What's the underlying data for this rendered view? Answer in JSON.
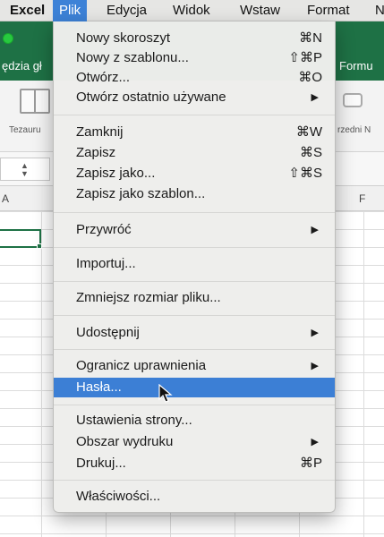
{
  "menubar": {
    "items": [
      "Excel",
      "Plik",
      "Edycja",
      "Widok",
      "Wstaw",
      "Format",
      "N"
    ]
  },
  "ribbon": {
    "tab_left": "ędzia gł",
    "tab_right": "Formu",
    "left_label": "Tezauru",
    "right_label": "rzedni N"
  },
  "sheet": {
    "columns": [
      "A",
      "F"
    ]
  },
  "file_menu": {
    "items": [
      {
        "label": "Nowy skoroszyt",
        "shortcut": "⌘N"
      },
      {
        "label": "Nowy z szablonu...",
        "shortcut": "⇧⌘P"
      },
      {
        "label": "Otwórz...",
        "shortcut": "⌘O"
      },
      {
        "label": "Otwórz ostatnio używane",
        "shortcut": "▶"
      },
      {
        "label": "Zamknij",
        "shortcut": "⌘W"
      },
      {
        "label": "Zapisz",
        "shortcut": "⌘S"
      },
      {
        "label": "Zapisz jako...",
        "shortcut": "⇧⌘S"
      },
      {
        "label": "Zapisz jako szablon...",
        "shortcut": ""
      },
      {
        "label": "Przywróć",
        "shortcut": "▶"
      },
      {
        "label": "Importuj...",
        "shortcut": ""
      },
      {
        "label": "Zmniejsz rozmiar pliku...",
        "shortcut": ""
      },
      {
        "label": "Udostępnij",
        "shortcut": "▶"
      },
      {
        "label": "Ogranicz uprawnienia",
        "shortcut": "▶"
      },
      {
        "label": "Hasła...",
        "shortcut": ""
      },
      {
        "label": "Ustawienia strony...",
        "shortcut": ""
      },
      {
        "label": "Obszar wydruku",
        "shortcut": "▶"
      },
      {
        "label": "Drukuj...",
        "shortcut": "⌘P"
      },
      {
        "label": "Właściwości...",
        "shortcut": ""
      }
    ]
  },
  "colors": {
    "excel_green": "#1e7145",
    "menu_highlight": "#3c7fd5",
    "menubar_active": "#3d82d7"
  }
}
